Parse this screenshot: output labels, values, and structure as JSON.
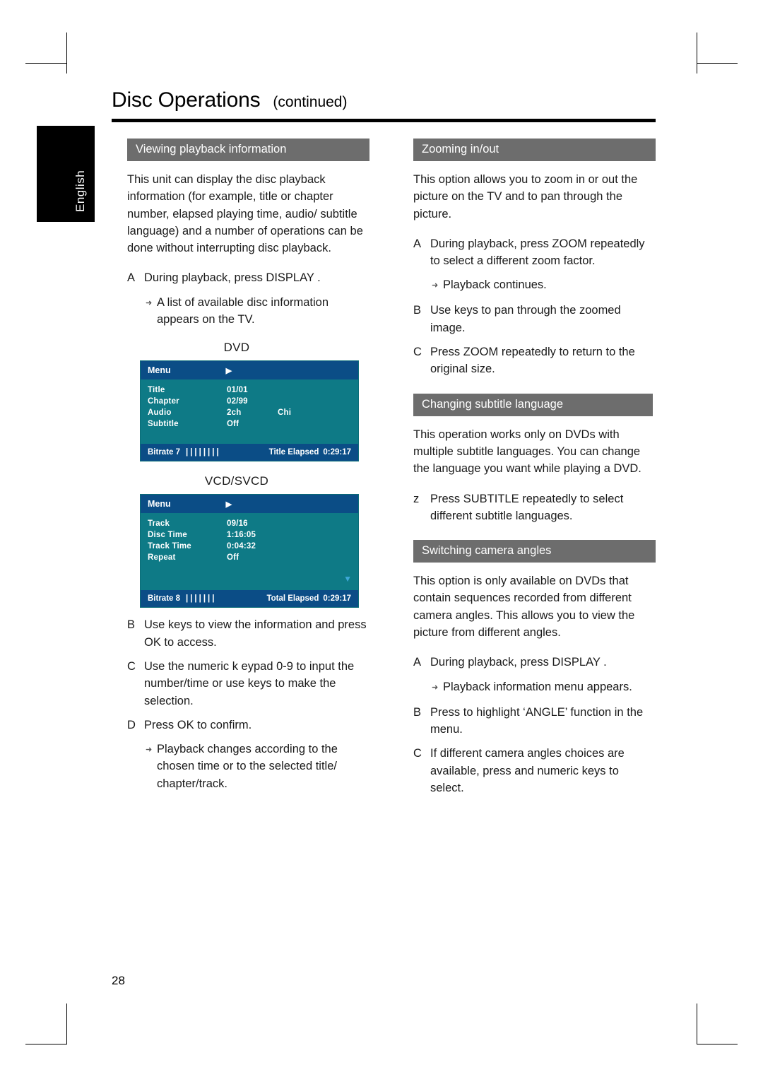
{
  "page": {
    "title": "Disc Operations",
    "continued": "(continued)",
    "language_tab": "English",
    "number": "28"
  },
  "left_column": {
    "section1": {
      "heading": "Viewing playback information",
      "intro": "This unit can display the disc playback information (for example, title or chapter number, elapsed playing time, audio/ subtitle language) and a number of operations can be done without interrupting disc playback.",
      "steps": [
        {
          "marker": "A",
          "text": "During playback, press DISPLAY ."
        },
        {
          "marker": "note",
          "text": "A list of available disc information appears on the TV."
        }
      ],
      "dvd_label": "DVD",
      "dvd_osd": {
        "menu_label": "Menu",
        "rows": [
          {
            "key": "Title",
            "value": "01/01",
            "value2": ""
          },
          {
            "key": "Chapter",
            "value": "02/99",
            "value2": ""
          },
          {
            "key": "Audio",
            "value": "2ch",
            "value2": "Chi"
          },
          {
            "key": "Subtitle",
            "value": "Off",
            "value2": ""
          }
        ],
        "bitrate_label": "Bitrate 7",
        "bitrate_bars": "||||||||",
        "elapsed_label": "Title Elapsed",
        "elapsed_value": "0:29:17"
      },
      "vcd_label": "VCD/SVCD",
      "vcd_osd": {
        "menu_label": "Menu",
        "rows": [
          {
            "key": "Track",
            "value": "09/16",
            "value2": ""
          },
          {
            "key": "Disc Time",
            "value": "1:16:05",
            "value2": ""
          },
          {
            "key": "Track Time",
            "value": "0:04:32",
            "value2": ""
          },
          {
            "key": "Repeat",
            "value": "Off",
            "value2": ""
          }
        ],
        "bitrate_label": "Bitrate 8",
        "bitrate_bars": "|||||||",
        "elapsed_label": "Total Elapsed",
        "elapsed_value": "0:29:17"
      },
      "steps2": [
        {
          "marker": "B",
          "text": "Use      keys to view the information and press OK  to access."
        },
        {
          "marker": "C",
          "text": "Use the numeric k eypad 0-9 to input the number/time or use      keys to make the selection."
        },
        {
          "marker": "D",
          "text": "Press OK  to confirm."
        },
        {
          "marker": "note",
          "text": "Playback changes according to the chosen time or to the selected title/ chapter/track."
        }
      ]
    }
  },
  "right_column": {
    "section_zoom": {
      "heading": "Zooming in/out",
      "intro": "This option allows you to zoom in or out the picture on the TV and to pan through the picture.",
      "steps": [
        {
          "marker": "A",
          "text": "During playback, press ZOOM repeatedly to select a different zoom factor."
        },
        {
          "marker": "note",
          "text": "Playback continues."
        },
        {
          "marker": "B",
          "text": "Use          keys to pan through the zoomed image."
        },
        {
          "marker": "C",
          "text": "Press ZOOM  repeatedly to return to the original size."
        }
      ]
    },
    "section_subtitle": {
      "heading": "Changing subtitle language",
      "intro": "This operation works only on DVDs with multiple subtitle languages. You can change the language you want while playing a DVD.",
      "steps": [
        {
          "marker": "z",
          "text": "Press SUBTITLE  repeatedly to select different subtitle languages."
        }
      ]
    },
    "section_angles": {
      "heading": "Switching camera angles",
      "intro": "This option is only available on DVDs that contain sequences recorded from different camera angles. This allows you to view the picture from different angles.",
      "steps": [
        {
          "marker": "A",
          "text": "During playback, press DISPLAY ."
        },
        {
          "marker": "note",
          "text": "Playback information menu appears."
        },
        {
          "marker": "B",
          "text": "Press   to highlight ‘ANGLE’ function in the menu."
        },
        {
          "marker": "C",
          "text": "If different camera angles choices are available, press   and numeric keys to select."
        }
      ]
    }
  }
}
